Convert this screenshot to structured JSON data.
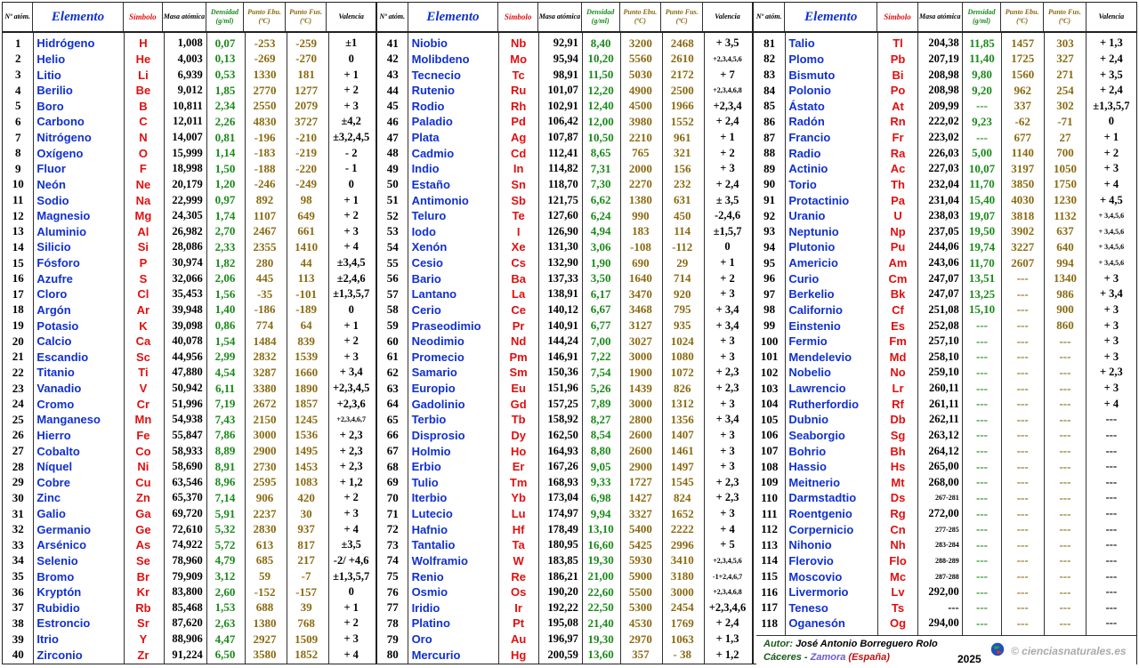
{
  "headers": {
    "num": "Nº atóm.",
    "element": "Elemento",
    "symbol": "Símbolo",
    "mass": "Masa atómica",
    "density": "Densidad (g/ml)",
    "boil": "Punto Ebu.(ºC)",
    "fus": "Punto Fus.(ºC)",
    "valence": "Valencia"
  },
  "elements": [
    [
      "1",
      "Hidrógeno",
      "H",
      "1,008",
      "0,07",
      "-253",
      "-259",
      "±1"
    ],
    [
      "2",
      "Helio",
      "He",
      "4,003",
      "0,13",
      "-269",
      "-270",
      "0"
    ],
    [
      "3",
      "Litio",
      "Li",
      "6,939",
      "0,53",
      "1330",
      "181",
      "+ 1"
    ],
    [
      "4",
      "Berilio",
      "Be",
      "9,012",
      "1,85",
      "2770",
      "1277",
      "+ 2"
    ],
    [
      "5",
      "Boro",
      "B",
      "10,811",
      "2,34",
      "2550",
      "2079",
      "+ 3"
    ],
    [
      "6",
      "Carbono",
      "C",
      "12,011",
      "2,26",
      "4830",
      "3727",
      "±4,2"
    ],
    [
      "7",
      "Nitrógeno",
      "N",
      "14,007",
      "0,81",
      "-196",
      "-210",
      "±3,2,4,5"
    ],
    [
      "8",
      "Oxígeno",
      "O",
      "15,999",
      "1,14",
      "-183",
      "-219",
      "- 2"
    ],
    [
      "9",
      "Fluor",
      "F",
      "18,998",
      "1,50",
      "-188",
      "-220",
      "- 1"
    ],
    [
      "10",
      "Neón",
      "Ne",
      "20,179",
      "1,20",
      "-246",
      "-249",
      "0"
    ],
    [
      "11",
      "Sodio",
      "Na",
      "22,999",
      "0,97",
      "892",
      "98",
      "+ 1"
    ],
    [
      "12",
      "Magnesio",
      "Mg",
      "24,305",
      "1,74",
      "1107",
      "649",
      "+ 2"
    ],
    [
      "13",
      "Aluminio",
      "Al",
      "26,982",
      "2,70",
      "2467",
      "661",
      "+ 3"
    ],
    [
      "14",
      "Silicio",
      "Si",
      "28,086",
      "2,33",
      "2355",
      "1410",
      "+ 4"
    ],
    [
      "15",
      "Fósforo",
      "P",
      "30,974",
      "1,82",
      "280",
      "44",
      "±3,4,5"
    ],
    [
      "16",
      "Azufre",
      "S",
      "32,066",
      "2,06",
      "445",
      "113",
      "±2,4,6"
    ],
    [
      "17",
      "Cloro",
      "Cl",
      "35,453",
      "1,56",
      "-35",
      "-101",
      "±1,3,5,7"
    ],
    [
      "18",
      "Argón",
      "Ar",
      "39,948",
      "1,40",
      "-186",
      "-189",
      "0"
    ],
    [
      "19",
      "Potasio",
      "K",
      "39,098",
      "0,86",
      "774",
      "64",
      "+ 1"
    ],
    [
      "20",
      "Calcio",
      "Ca",
      "40,078",
      "1,54",
      "1484",
      "839",
      "+ 2"
    ],
    [
      "21",
      "Escandio",
      "Sc",
      "44,956",
      "2,99",
      "2832",
      "1539",
      "+ 3"
    ],
    [
      "22",
      "Titanio",
      "Ti",
      "47,880",
      "4,54",
      "3287",
      "1660",
      "+ 3,4"
    ],
    [
      "23",
      "Vanadio",
      "V",
      "50,942",
      "6,11",
      "3380",
      "1890",
      "+2,3,4,5"
    ],
    [
      "24",
      "Cromo",
      "Cr",
      "51,996",
      "7,19",
      "2672",
      "1857",
      "+2,3,6"
    ],
    [
      "25",
      "Manganeso",
      "Mn",
      "54,938",
      "7,43",
      "2150",
      "1245",
      "+2,3,4,6,7"
    ],
    [
      "26",
      "Hierro",
      "Fe",
      "55,847",
      "7,86",
      "3000",
      "1536",
      "+ 2,3"
    ],
    [
      "27",
      "Cobalto",
      "Co",
      "58,933",
      "8,89",
      "2900",
      "1495",
      "+ 2,3"
    ],
    [
      "28",
      "Níquel",
      "Ni",
      "58,690",
      "8,91",
      "2730",
      "1453",
      "+ 2,3"
    ],
    [
      "29",
      "Cobre",
      "Cu",
      "63,546",
      "8,96",
      "2595",
      "1083",
      "+ 1,2"
    ],
    [
      "30",
      "Zinc",
      "Zn",
      "65,370",
      "7,14",
      "906",
      "420",
      "+ 2"
    ],
    [
      "31",
      "Galio",
      "Ga",
      "69,720",
      "5,91",
      "2237",
      "30",
      "+ 3"
    ],
    [
      "32",
      "Germanio",
      "Ge",
      "72,610",
      "5,32",
      "2830",
      "937",
      "+ 4"
    ],
    [
      "33",
      "Arsénico",
      "As",
      "74,922",
      "5,72",
      "613",
      "817",
      "±3,5"
    ],
    [
      "34",
      "Selenio",
      "Se",
      "78,960",
      "4,79",
      "685",
      "217",
      "-2/ +4,6"
    ],
    [
      "35",
      "Bromo",
      "Br",
      "79,909",
      "3,12",
      "59",
      "-7",
      "±1,3,5,7"
    ],
    [
      "36",
      "Kryptón",
      "Kr",
      "83,800",
      "2,60",
      "-152",
      "-157",
      "0"
    ],
    [
      "37",
      "Rubidio",
      "Rb",
      "85,468",
      "1,53",
      "688",
      "39",
      "+ 1"
    ],
    [
      "38",
      "Estroncio",
      "Sr",
      "87,620",
      "2,63",
      "1380",
      "768",
      "+ 2"
    ],
    [
      "39",
      "Itrio",
      "Y",
      "88,906",
      "4,47",
      "2927",
      "1509",
      "+ 3"
    ],
    [
      "40",
      "Zirconio",
      "Zr",
      "91,224",
      "6,50",
      "3580",
      "1852",
      "+ 4"
    ],
    [
      "41",
      "Niobio",
      "Nb",
      "92,91",
      "8,40",
      "3200",
      "2468",
      "+ 3,5"
    ],
    [
      "42",
      "Molibdeno",
      "Mo",
      "95,94",
      "10,20",
      "5560",
      "2610",
      "+2,3,4,5,6"
    ],
    [
      "43",
      "Tecnecio",
      "Tc",
      "98,91",
      "11,50",
      "5030",
      "2172",
      "+ 7"
    ],
    [
      "44",
      "Rutenio",
      "Ru",
      "101,07",
      "12,20",
      "4900",
      "2500",
      "+2,3,4,6,8"
    ],
    [
      "45",
      "Rodio",
      "Rh",
      "102,91",
      "12,40",
      "4500",
      "1966",
      "+2,3,4"
    ],
    [
      "46",
      "Paladio",
      "Pd",
      "106,42",
      "12,00",
      "3980",
      "1552",
      "+ 2,4"
    ],
    [
      "47",
      "Plata",
      "Ag",
      "107,87",
      "10,50",
      "2210",
      "961",
      "+ 1"
    ],
    [
      "48",
      "Cadmio",
      "Cd",
      "112,41",
      "8,65",
      "765",
      "321",
      "+ 2"
    ],
    [
      "49",
      "Indio",
      "In",
      "114,82",
      "7,31",
      "2000",
      "156",
      "+ 3"
    ],
    [
      "50",
      "Estaño",
      "Sn",
      "118,70",
      "7,30",
      "2270",
      "232",
      "+ 2,4"
    ],
    [
      "51",
      "Antimonio",
      "Sb",
      "121,75",
      "6,62",
      "1380",
      "631",
      "± 3,5"
    ],
    [
      "52",
      "Teluro",
      "Te",
      "127,60",
      "6,24",
      "990",
      "450",
      "-2,4,6"
    ],
    [
      "53",
      "Iodo",
      "I",
      "126,90",
      "4,94",
      "183",
      "114",
      "±1,5,7"
    ],
    [
      "54",
      "Xenón",
      "Xe",
      "131,30",
      "3,06",
      "-108",
      "-112",
      "0"
    ],
    [
      "55",
      "Cesio",
      "Cs",
      "132,90",
      "1,90",
      "690",
      "29",
      "+ 1"
    ],
    [
      "56",
      "Bario",
      "Ba",
      "137,33",
      "3,50",
      "1640",
      "714",
      "+ 2"
    ],
    [
      "57",
      "Lantano",
      "La",
      "138,91",
      "6,17",
      "3470",
      "920",
      "+ 3"
    ],
    [
      "58",
      "Cerio",
      "Ce",
      "140,12",
      "6,67",
      "3468",
      "795",
      "+ 3,4"
    ],
    [
      "59",
      "Praseodimio",
      "Pr",
      "140,91",
      "6,77",
      "3127",
      "935",
      "+ 3,4"
    ],
    [
      "60",
      "Neodimio",
      "Nd",
      "144,24",
      "7,00",
      "3027",
      "1024",
      "+ 3"
    ],
    [
      "61",
      "Promecio",
      "Pm",
      "146,91",
      "7,22",
      "3000",
      "1080",
      "+ 3"
    ],
    [
      "62",
      "Samario",
      "Sm",
      "150,36",
      "7,54",
      "1900",
      "1072",
      "+ 2,3"
    ],
    [
      "63",
      "Europio",
      "Eu",
      "151,96",
      "5,26",
      "1439",
      "826",
      "+ 2,3"
    ],
    [
      "64",
      "Gadolinio",
      "Gd",
      "157,25",
      "7,89",
      "3000",
      "1312",
      "+ 3"
    ],
    [
      "65",
      "Terbio",
      "Tb",
      "158,92",
      "8,27",
      "2800",
      "1356",
      "+ 3,4"
    ],
    [
      "66",
      "Disprosio",
      "Dy",
      "162,50",
      "8,54",
      "2600",
      "1407",
      "+ 3"
    ],
    [
      "67",
      "Holmio",
      "Ho",
      "164,93",
      "8,80",
      "2600",
      "1461",
      "+ 3"
    ],
    [
      "68",
      "Erbio",
      "Er",
      "167,26",
      "9,05",
      "2900",
      "1497",
      "+ 3"
    ],
    [
      "69",
      "Tulio",
      "Tm",
      "168,93",
      "9,33",
      "1727",
      "1545",
      "+ 2,3"
    ],
    [
      "70",
      "Iterbio",
      "Yb",
      "173,04",
      "6,98",
      "1427",
      "824",
      "+ 2,3"
    ],
    [
      "71",
      "Lutecio",
      "Lu",
      "174,97",
      "9,94",
      "3327",
      "1652",
      "+ 3"
    ],
    [
      "72",
      "Hafnio",
      "Hf",
      "178,49",
      "13,10",
      "5400",
      "2222",
      "+ 4"
    ],
    [
      "73",
      "Tantalio",
      "Ta",
      "180,95",
      "16,60",
      "5425",
      "2996",
      "+ 5"
    ],
    [
      "74",
      "Wolframio",
      "W",
      "183,85",
      "19,30",
      "5930",
      "3410",
      "+2,3,4,5,6"
    ],
    [
      "75",
      "Renio",
      "Re",
      "186,21",
      "21,00",
      "5900",
      "3180",
      "-1+2,4,6,7"
    ],
    [
      "76",
      "Osmio",
      "Os",
      "190,20",
      "22,60",
      "5500",
      "3000",
      "+2,3,4,6,8"
    ],
    [
      "77",
      "Iridio",
      "Ir",
      "192,22",
      "22,50",
      "5300",
      "2454",
      "+2,3,4,6"
    ],
    [
      "78",
      "Platino",
      "Pt",
      "195,08",
      "21,40",
      "4530",
      "1769",
      "+ 2,4"
    ],
    [
      "79",
      "Oro",
      "Au",
      "196,97",
      "19,30",
      "2970",
      "1063",
      "+ 1,3"
    ],
    [
      "80",
      "Mercurio",
      "Hg",
      "200,59",
      "13,60",
      "357",
      "- 38",
      "+ 1,2"
    ],
    [
      "81",
      "Talio",
      "Tl",
      "204,38",
      "11,85",
      "1457",
      "303",
      "+ 1,3"
    ],
    [
      "82",
      "Plomo",
      "Pb",
      "207,19",
      "11,40",
      "1725",
      "327",
      "+ 2,4"
    ],
    [
      "83",
      "Bismuto",
      "Bi",
      "208,98",
      "9,80",
      "1560",
      "271",
      "+ 3,5"
    ],
    [
      "84",
      "Polonio",
      "Po",
      "208,98",
      "9,20",
      "962",
      "254",
      "+ 2,4"
    ],
    [
      "85",
      "Ástato",
      "At",
      "209,99",
      "---",
      "337",
      "302",
      "±1,3,5,7"
    ],
    [
      "86",
      "Radón",
      "Rn",
      "222,02",
      "9,23",
      "-62",
      "-71",
      "0"
    ],
    [
      "87",
      "Francio",
      "Fr",
      "223,02",
      "---",
      "677",
      "27",
      "+ 1"
    ],
    [
      "88",
      "Radio",
      "Ra",
      "226,03",
      "5,00",
      "1140",
      "700",
      "+ 2"
    ],
    [
      "89",
      "Actinio",
      "Ac",
      "227,03",
      "10,07",
      "3197",
      "1050",
      "+ 3"
    ],
    [
      "90",
      "Torio",
      "Th",
      "232,04",
      "11,70",
      "3850",
      "1750",
      "+ 4"
    ],
    [
      "91",
      "Protactinio",
      "Pa",
      "231,04",
      "15,40",
      "4030",
      "1230",
      "+ 4,5"
    ],
    [
      "92",
      "Uranio",
      "U",
      "238,03",
      "19,07",
      "3818",
      "1132",
      "+ 3,4,5,6"
    ],
    [
      "93",
      "Neptunio",
      "Np",
      "237,05",
      "19,50",
      "3902",
      "637",
      "+ 3,4,5,6"
    ],
    [
      "94",
      "Plutonio",
      "Pu",
      "244,06",
      "19,74",
      "3227",
      "640",
      "+ 3,4,5,6"
    ],
    [
      "95",
      "Americio",
      "Am",
      "243,06",
      "11,70",
      "2607",
      "994",
      "+ 3,4,5,6"
    ],
    [
      "96",
      "Curio",
      "Cm",
      "247,07",
      "13,51",
      "---",
      "1340",
      "+ 3"
    ],
    [
      "97",
      "Berkelio",
      "Bk",
      "247,07",
      "13,25",
      "---",
      "986",
      "+ 3,4"
    ],
    [
      "98",
      "Californio",
      "Cf",
      "251,08",
      "15,10",
      "---",
      "900",
      "+ 3"
    ],
    [
      "99",
      "Einstenio",
      "Es",
      "252,08",
      "---",
      "---",
      "860",
      "+ 3"
    ],
    [
      "100",
      "Fermio",
      "Fm",
      "257,10",
      "---",
      "---",
      "---",
      "+ 3"
    ],
    [
      "101",
      "Mendelevio",
      "Md",
      "258,10",
      "---",
      "---",
      "---",
      "+ 3"
    ],
    [
      "102",
      "Nobelio",
      "No",
      "259,10",
      "---",
      "---",
      "---",
      "+ 2,3"
    ],
    [
      "103",
      "Lawrencio",
      "Lr",
      "260,11",
      "---",
      "---",
      "---",
      "+ 3"
    ],
    [
      "104",
      "Rutherfordio",
      "Rf",
      "261,11",
      "---",
      "---",
      "---",
      "+ 4"
    ],
    [
      "105",
      "Dubnio",
      "Db",
      "262,11",
      "---",
      "---",
      "---",
      "---"
    ],
    [
      "106",
      "Seaborgio",
      "Sg",
      "263,12",
      "---",
      "---",
      "---",
      "---"
    ],
    [
      "107",
      "Bohrio",
      "Bh",
      "264,12",
      "---",
      "---",
      "---",
      "---"
    ],
    [
      "108",
      "Hassio",
      "Hs",
      "265,00",
      "---",
      "---",
      "---",
      "---"
    ],
    [
      "109",
      "Meitnerio",
      "Mt",
      "268,00",
      "---",
      "---",
      "---",
      "---"
    ],
    [
      "110",
      "Darmstadtio",
      "Ds",
      "267-281",
      "---",
      "---",
      "---",
      "---"
    ],
    [
      "111",
      "Roentgenio",
      "Rg",
      "272,00",
      "---",
      "---",
      "---",
      "---"
    ],
    [
      "112",
      "Corpernicio",
      "Cn",
      "277-285",
      "---",
      "---",
      "---",
      "---"
    ],
    [
      "113",
      "Nihonio",
      "Nh",
      "283-284",
      "---",
      "---",
      "---",
      "---"
    ],
    [
      "114",
      "Flerovio",
      "Flo",
      "288-289",
      "---",
      "---",
      "---",
      "---"
    ],
    [
      "115",
      "Moscovio",
      "Mc",
      "287-288",
      "---",
      "---",
      "---",
      "---"
    ],
    [
      "116",
      "Livermorio",
      "Lv",
      "292,00",
      "---",
      "---",
      "---",
      "---"
    ],
    [
      "117",
      "Teneso",
      "Ts",
      "---",
      "---",
      "---",
      "---",
      "---"
    ],
    [
      "118",
      "Oganesón",
      "Og",
      "294,00",
      "---",
      "---",
      "---",
      "---"
    ]
  ],
  "footer": {
    "author_label": "Autor:",
    "author_name": "José Antonio Borreguero Rolo",
    "city": "Cáceres",
    "province": "Zamora",
    "country": "(España)",
    "year": "2025",
    "site": "© cienciasnaturales.es",
    "logo_icon": "globe-icon"
  },
  "colors": {
    "element_name": "#1030d0",
    "symbol": "#e01010",
    "density": "#1a8a1a",
    "temperatures": "#8a6a10"
  }
}
